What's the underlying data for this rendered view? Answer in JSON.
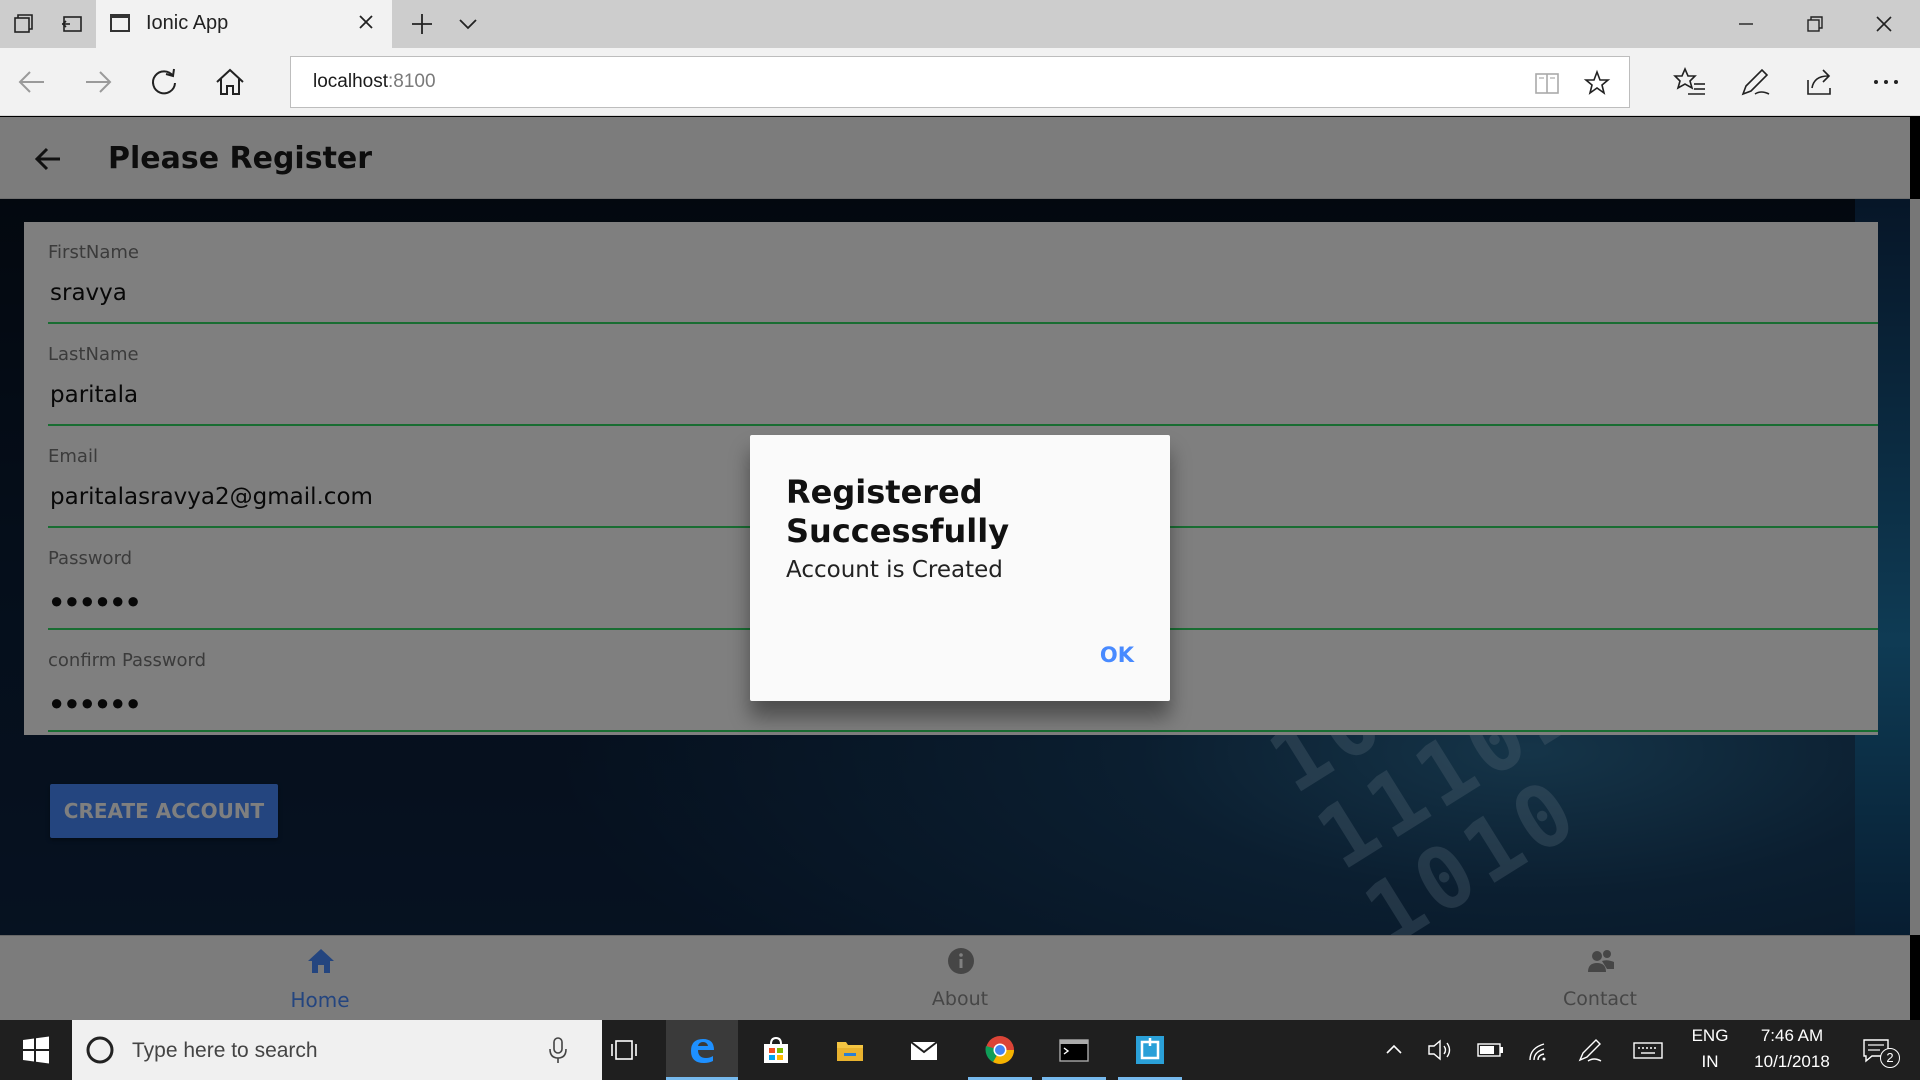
{
  "browser": {
    "tab_title": "Ionic App",
    "url_host": "localhost",
    "url_port": ":8100"
  },
  "app": {
    "page_title": "Please Register",
    "fields": [
      {
        "label": "FirstName",
        "value": "sravya",
        "type": "text"
      },
      {
        "label": "LastName",
        "value": "paritala",
        "type": "text"
      },
      {
        "label": "Email",
        "value": "paritalasravya2@gmail.com",
        "type": "text"
      },
      {
        "label": "Password",
        "value": "●●●●●●",
        "type": "password"
      },
      {
        "label": "confirm Password",
        "value": "●●●●●●",
        "type": "password"
      }
    ],
    "create_button": "CREATE ACCOUNT",
    "tabs": [
      {
        "label": "Home",
        "icon": "home-icon",
        "active": true
      },
      {
        "label": "About",
        "icon": "info-icon",
        "active": false
      },
      {
        "label": "Contact",
        "icon": "contacts-icon",
        "active": false
      }
    ],
    "accent_color": "#488aff",
    "valid_underline_color": "#32db64"
  },
  "alert": {
    "title": "Registered Successfully",
    "message": "Account is Created",
    "ok_label": "OK"
  },
  "taskbar": {
    "search_placeholder": "Type here to search",
    "language": "ENG",
    "region": "IN",
    "time": "7:46 AM",
    "date": "10/1/2018",
    "notification_count": "2"
  }
}
